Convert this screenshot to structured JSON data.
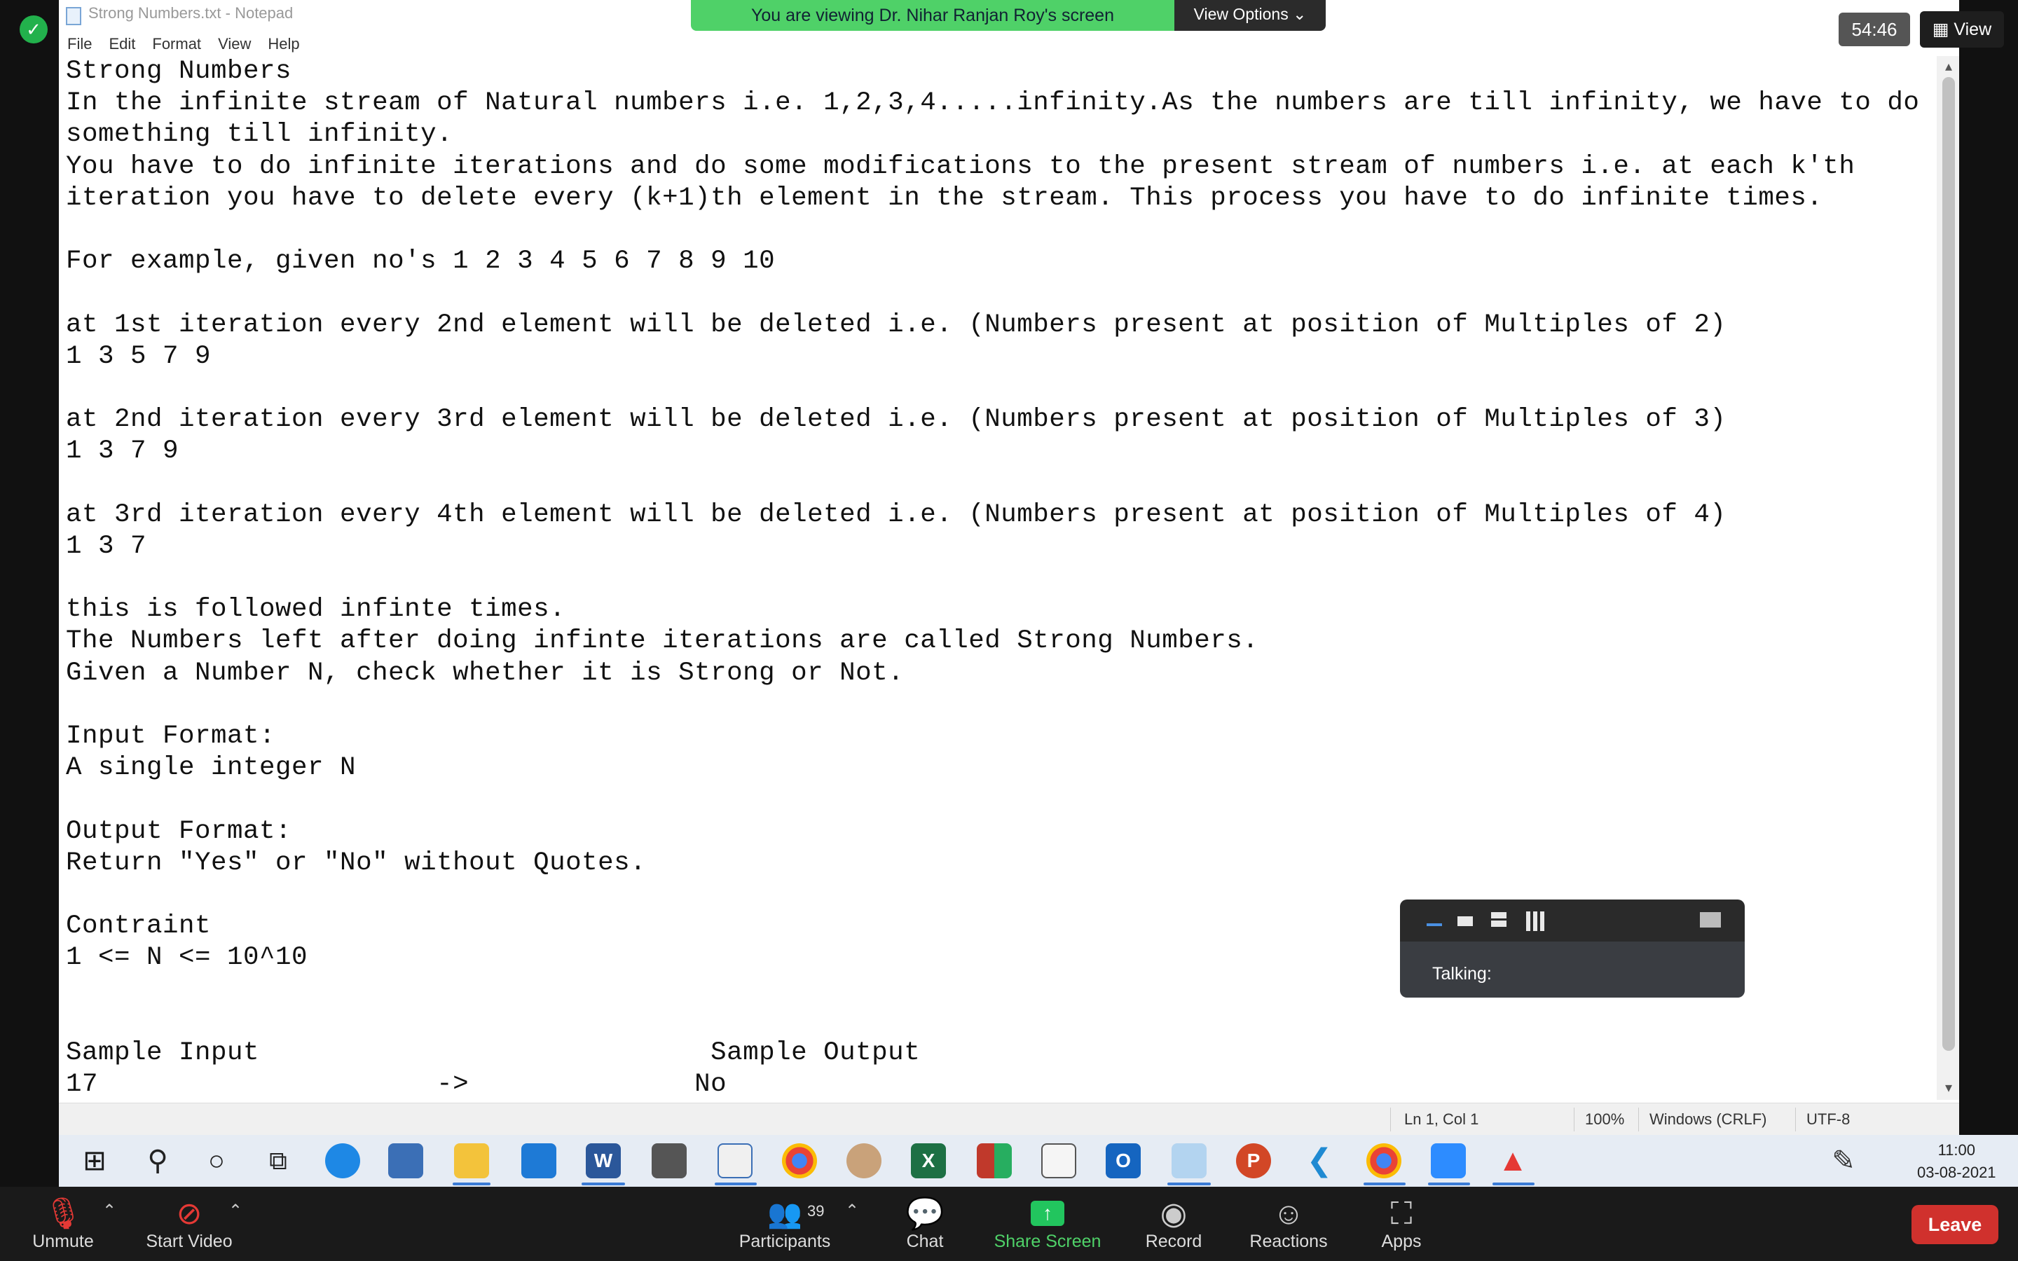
{
  "notepad": {
    "title": "Strong Numbers.txt - Notepad",
    "menu": [
      "File",
      "Edit",
      "Format",
      "View",
      "Help"
    ],
    "lines": [
      "Strong Numbers",
      "In the infinite stream of Natural numbers i.e. 1,2,3,4.....infinity.As the numbers are till infinity, we have to do",
      "something till infinity.",
      "You have to do infinite iterations and do some modifications to the present stream of numbers i.e. at each k'th",
      "iteration you have to delete every (k+1)th element in the stream. This process you have to do infinite times.",
      "",
      "For example, given no's 1 2 3 4 5 6 7 8 9 10",
      "",
      "at 1st iteration every 2nd element will be deleted i.e. (Numbers present at position of Multiples of 2)",
      "1 3 5 7 9",
      "",
      "at 2nd iteration every 3rd element will be deleted i.e. (Numbers present at position of Multiples of 3)",
      "1 3 7 9",
      "",
      "at 3rd iteration every 4th element will be deleted i.e. (Numbers present at position of Multiples of 4)",
      "1 3 7",
      "",
      "this is followed infinte times.",
      "The Numbers left after doing infinte iterations are called Strong Numbers.",
      "Given a Number N, check whether it is Strong or Not.",
      "",
      "Input Format:",
      "A single integer N",
      "",
      "Output Format:",
      "Return \"Yes\" or \"No\" without Quotes.",
      "",
      "Contraint",
      "1 <= N <= 10^10",
      "",
      "",
      "Sample Input                            Sample Output",
      "17                     ->              No"
    ],
    "status": {
      "position": "Ln 1, Col 1",
      "zoom": "100%",
      "line_ending": "Windows (CRLF)",
      "encoding": "UTF-8"
    }
  },
  "zoom": {
    "banner_text": "You are viewing Dr. Nihar Ranjan Roy's screen",
    "view_options": "View Options ⌄",
    "timer": "54:46",
    "view_button": "View",
    "talking": "Talking:",
    "toolbar": {
      "unmute": "Unmute",
      "start_video": "Start Video",
      "participants": "Participants",
      "participants_count": "39",
      "chat": "Chat",
      "share_screen": "Share Screen",
      "record": "Record",
      "reactions": "Reactions",
      "apps": "Apps",
      "leave": "Leave"
    }
  },
  "taskbar": {
    "time": "11:00",
    "date": "03-08-2021"
  },
  "colors": {
    "share_green": "#4fd168",
    "leave_red": "#d0312d",
    "shield_green": "#22b14c"
  }
}
